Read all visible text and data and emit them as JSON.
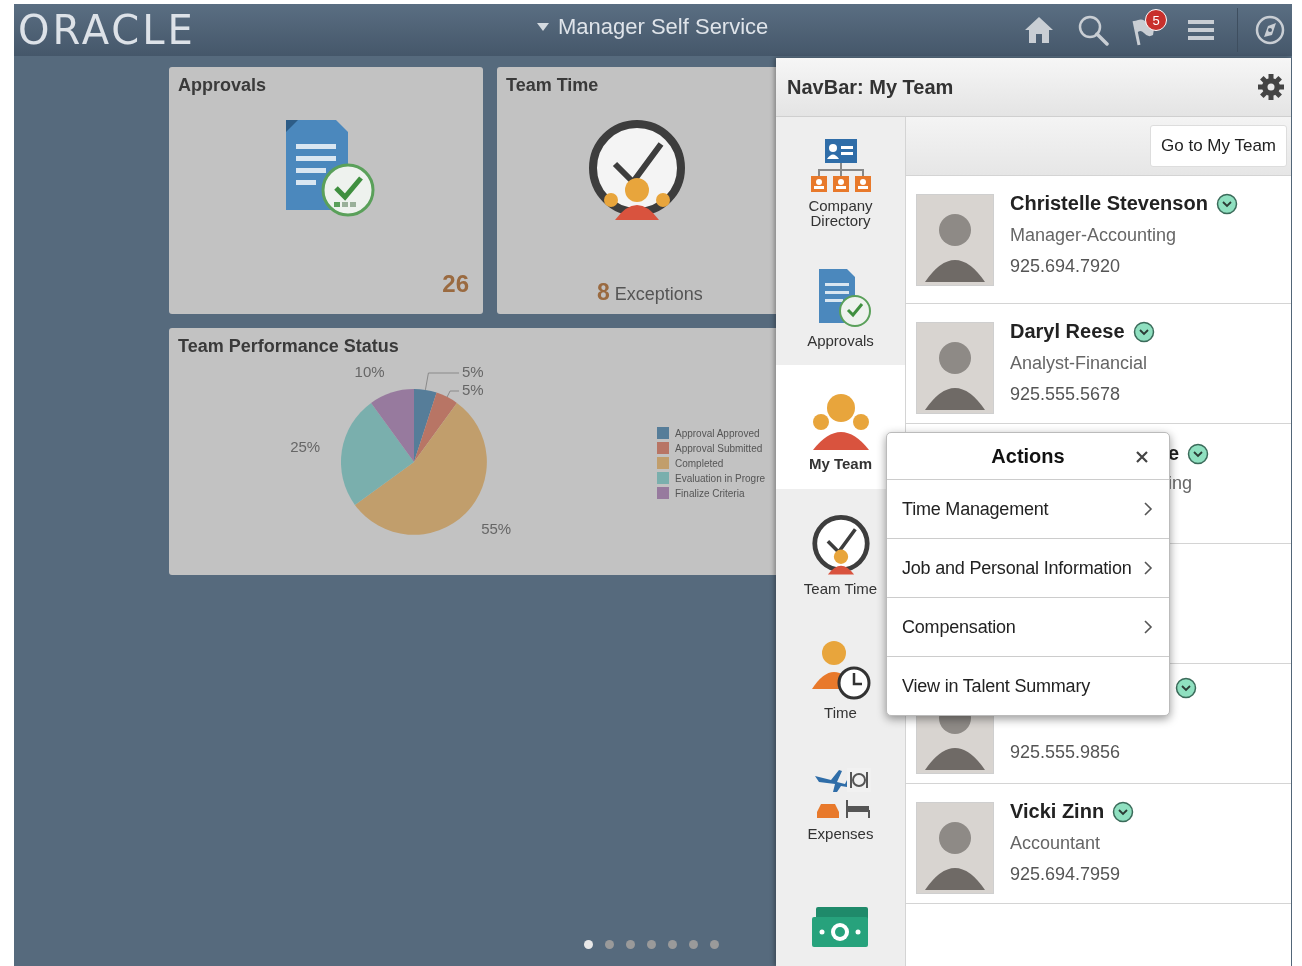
{
  "header": {
    "logo": "ORACLE",
    "title": "Manager Self Service",
    "notification_count": "5"
  },
  "tiles": [
    {
      "kind": "approvals",
      "title": "Approvals",
      "count": "26"
    },
    {
      "kind": "team_time",
      "title": "Team Time",
      "count": "8",
      "count_label": "Exceptions"
    },
    {
      "kind": "chart",
      "title": "Team Performance Status",
      "chart_data": {
        "type": "pie",
        "categories": [
          "Approval Approved",
          "Approval Submitted",
          "Completed",
          "Evaluation in Progre",
          "Finalize Criteria"
        ],
        "values": [
          5,
          5,
          55,
          25,
          10
        ],
        "value_labels": [
          "5%",
          "5%",
          "55%",
          "25%",
          "10%"
        ],
        "legend": "right"
      }
    }
  ],
  "page_dots": [
    {
      "selected": true
    },
    {
      "selected": false
    },
    {
      "selected": false
    },
    {
      "selected": false
    },
    {
      "selected": false
    },
    {
      "selected": false
    },
    {
      "selected": false
    }
  ],
  "panel": {
    "title": "NavBar: My Team",
    "go_button": "Go to My Team",
    "nav_items": [
      {
        "kind": "directory",
        "label": "Company Directory",
        "selected": false
      },
      {
        "kind": "approvals",
        "label": "Approvals",
        "selected": false
      },
      {
        "kind": "team",
        "label": "My Team",
        "selected": true
      },
      {
        "kind": "team_time",
        "label": "Team Time",
        "selected": false
      },
      {
        "kind": "time",
        "label": "Time",
        "selected": false
      },
      {
        "kind": "expenses",
        "label": "Expenses",
        "selected": false
      },
      {
        "kind": "money",
        "selected": false
      }
    ],
    "people": [
      {
        "kind": "full",
        "name": "Christelle Stevenson",
        "title": "Manager-Accounting",
        "phone": "925.694.7920"
      },
      {
        "kind": "full",
        "name": "Daryl Reese",
        "title": "Analyst-Financial",
        "phone": "925.555.5678"
      },
      {
        "kind": "covered_top",
        "name": "e",
        "title": "ing"
      },
      {
        "kind": "covered"
      },
      {
        "kind": "covered_bottom",
        "phone": "925.555.9856"
      },
      {
        "kind": "full",
        "name": "Vicki Zinn",
        "title": "Accountant",
        "phone": "925.694.7959"
      }
    ]
  },
  "actions_menu": {
    "title": "Actions",
    "items": [
      {
        "label": "Time Management",
        "submenu": true
      },
      {
        "label": "Job and Personal Information",
        "submenu": true
      },
      {
        "label": "Compensation",
        "submenu": true
      },
      {
        "label": "View in Talent Summary",
        "submenu": false
      }
    ]
  }
}
